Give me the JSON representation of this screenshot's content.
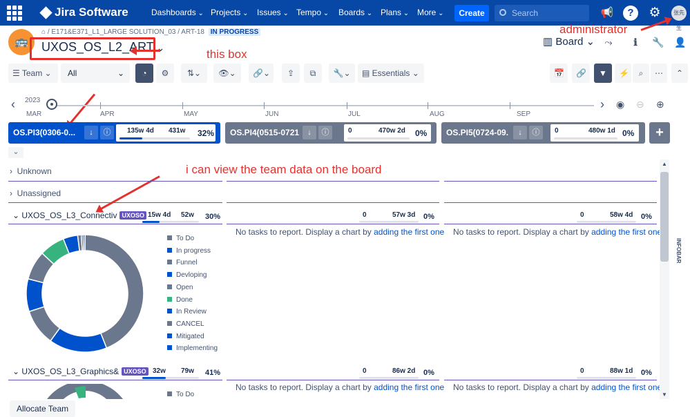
{
  "nav": {
    "app_name": "Jira Software",
    "items": [
      "Dashboards",
      "Projects",
      "Issues",
      "Tempo",
      "Boards",
      "Plans",
      "More"
    ],
    "create_label": "Create",
    "search_placeholder": "Search",
    "avatar_text": "张先生"
  },
  "header": {
    "breadcrumb": "/ E171&E371_L1_LARGE SOLUTION_03 / ART-18",
    "status": "IN PROGRESS",
    "project_title": "UXOS_OS_L2_ART",
    "board_label": "Board"
  },
  "annotations": {
    "this_box": "this box",
    "administrator": "administrator",
    "team_data": "i can view the team data on the board"
  },
  "toolbar": {
    "team_label": "Team",
    "filter_value": "All",
    "essentials_label": "Essentials"
  },
  "timeline": {
    "year": "2023",
    "months": [
      "MAR",
      "APR",
      "MAY",
      "JUN",
      "JUL",
      "AUG",
      "SEP"
    ]
  },
  "pis": [
    {
      "name": "OS.PI3(0306-0...",
      "v1": "135w 4d",
      "v2": "431w",
      "pct": "32%",
      "progress": 0.32
    },
    {
      "name": "OS.PI4(0515-0721)",
      "v1": "0",
      "v2": "470w 2d",
      "pct": "0%",
      "progress": 0
    },
    {
      "name": "OS.PI5(0724-09...",
      "v1": "0",
      "v2": "480w 1d",
      "pct": "0%",
      "progress": 0
    }
  ],
  "groups": {
    "unknown": "Unknown",
    "unassigned": "Unassigned"
  },
  "teams": [
    {
      "name": "UXOS_OS_L3_Connectiv",
      "tag": "UXOSO",
      "v1": "15w 4d",
      "v2": "52w",
      "pct": "30%",
      "progress": 0.3,
      "cells": [
        {
          "v1": "0",
          "v2": "57w 3d",
          "pct": "0%"
        },
        {
          "v1": "0",
          "v2": "58w 4d",
          "pct": "0%"
        }
      ]
    },
    {
      "name": "UXOS_OS_L3_Graphics&",
      "tag": "UXOSO",
      "v1": "32w",
      "v2": "79w",
      "pct": "41%",
      "progress": 0.41,
      "cells": [
        {
          "v1": "0",
          "v2": "86w 2d",
          "pct": "0%"
        },
        {
          "v1": "0",
          "v2": "88w 1d",
          "pct": "0%"
        }
      ]
    }
  ],
  "no_tasks": {
    "text": "No tasks to report. Display a chart by ",
    "link": "adding the first one"
  },
  "legend": [
    {
      "label": "To Do",
      "color": "#6b778c"
    },
    {
      "label": "In progress",
      "color": "#0052cc"
    },
    {
      "label": "Funnel",
      "color": "#6b778c"
    },
    {
      "label": "Devloping",
      "color": "#0052cc"
    },
    {
      "label": "Open",
      "color": "#6b778c"
    },
    {
      "label": "Done",
      "color": "#36b37e"
    },
    {
      "label": "In Review",
      "color": "#0052cc"
    },
    {
      "label": "CANCEL",
      "color": "#6b778c"
    },
    {
      "label": "Mitigated",
      "color": "#0052cc"
    },
    {
      "label": "Implementing",
      "color": "#0052cc"
    }
  ],
  "donut_shares": [
    0.44,
    0.16,
    0.1,
    0.09,
    0.08,
    0.07,
    0.04,
    0.01,
    0.005,
    0.005
  ],
  "second_legend_first": "To Do",
  "side_panel_label": "INFOBAR",
  "allocate_label": "Allocate Team"
}
